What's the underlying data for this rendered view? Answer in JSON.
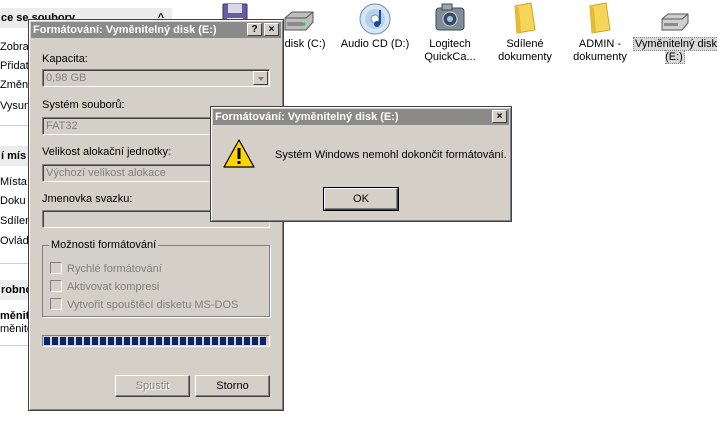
{
  "taskpane": {
    "sections": [
      {
        "title": "ce se soubory",
        "chevron": "^",
        "items": [
          "Zobra",
          "Přidat",
          "Změni",
          "Vysun"
        ]
      },
      {
        "title": "í mís",
        "items": [
          "Místa",
          "Doku",
          "Sdíler",
          "Ovlád"
        ]
      },
      {
        "title": "robno",
        "items": []
      }
    ],
    "details_name": "měnitel",
    "details_sub": "měnitelný"
  },
  "icons": [
    {
      "name": "floppy-drive",
      "label": ""
    },
    {
      "name": "local-disk-c",
      "label": "ní disk (C:)"
    },
    {
      "name": "audio-cd-d",
      "label": "Audio CD (D:)"
    },
    {
      "name": "logitech-quickcam",
      "label": "Logitech QuickCa..."
    },
    {
      "name": "shared-documents",
      "label": "Sdílené dokumenty"
    },
    {
      "name": "admin-documents",
      "label": "ADMIN - dokumenty"
    },
    {
      "name": "removable-disk-e",
      "label": "Vyměnitelný disk (E:)"
    }
  ],
  "format_dialog": {
    "title": "Formátování: Vyměnitelný disk (E:)",
    "help_btn": "?",
    "close_btn": "×",
    "capacity_label": "Kapacita:",
    "capacity_value": "0,98 GB",
    "filesystem_label": "Systém souborů:",
    "filesystem_value": "FAT32",
    "alloc_label": "Velikost alokační jednotky:",
    "alloc_value": "Výchozí velikost alokace",
    "volume_label": "Jmenovka svazku:",
    "volume_value": "",
    "options_title": "Možnosti formátování",
    "options": [
      "Rychlé formátování",
      "Aktivovat kompresi",
      "Vytvořit spouštěcí disketu MS-DOS"
    ],
    "progress": 1.0,
    "start_btn": "Spustit",
    "cancel_btn": "Storno"
  },
  "message_box": {
    "title": "Formátování: Vyměnitelný disk (E:)",
    "close_btn": "×",
    "message": "Systém Windows nemohl dokončit formátování.",
    "ok_btn": "OK"
  }
}
